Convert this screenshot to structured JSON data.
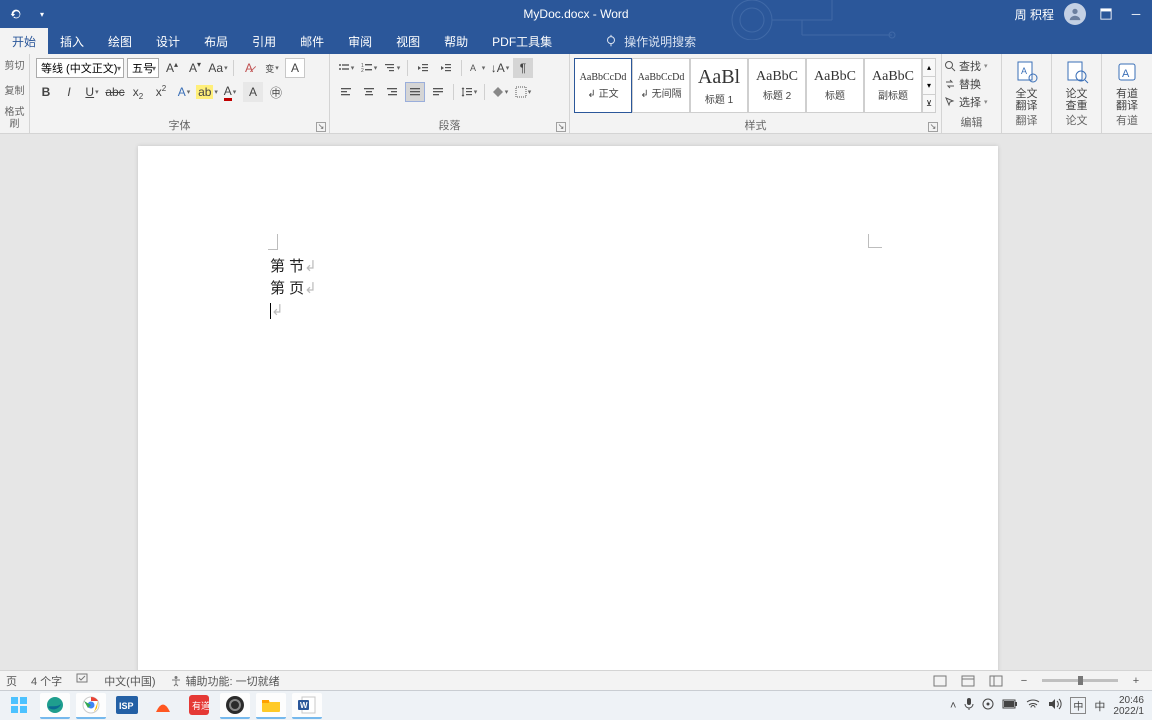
{
  "app": {
    "title": "MyDoc.docx - Word",
    "user": "周 积程"
  },
  "tabs": {
    "items": [
      "开始",
      "插入",
      "绘图",
      "设计",
      "布局",
      "引用",
      "邮件",
      "审阅",
      "视图",
      "帮助",
      "PDF工具集"
    ],
    "active_index": 0,
    "tell_me": "操作说明搜索"
  },
  "clipboard": {
    "cut": "剪切",
    "copy": "复制",
    "painter": "格式刷"
  },
  "font": {
    "label": "字体",
    "name": "等线 (中文正文)",
    "size": "五号"
  },
  "paragraph": {
    "label": "段落"
  },
  "styles": {
    "label": "样式",
    "items": [
      {
        "preview": "AaBbCcDd",
        "name": "↲ 正文",
        "size": 10
      },
      {
        "preview": "AaBbCcDd",
        "name": "↲ 无间隔",
        "size": 10
      },
      {
        "preview": "AaBl",
        "name": "标题 1",
        "size": 20
      },
      {
        "preview": "AaBbC",
        "name": "标题 2",
        "size": 14
      },
      {
        "preview": "AaBbC",
        "name": "标题",
        "size": 14
      },
      {
        "preview": "AaBbC",
        "name": "副标题",
        "size": 14
      }
    ]
  },
  "editing": {
    "label": "编辑",
    "find": "查找",
    "replace": "替换",
    "select": "选择"
  },
  "extras": {
    "translate_full": "全文\n翻译",
    "translate_label": "翻译",
    "thesis_check": "论文\n查重",
    "thesis_label": "论文",
    "youdao": "有道\n翻译",
    "youdao_label": "有道"
  },
  "document": {
    "line1": "第 节",
    "line2": "第 页"
  },
  "status": {
    "page": "页",
    "words": "4 个字",
    "lang": "中文(中国)",
    "a11y": "辅助功能: 一切就绪"
  },
  "taskbar": {
    "time": "20:46",
    "date": "2022/1",
    "ime": "中"
  }
}
